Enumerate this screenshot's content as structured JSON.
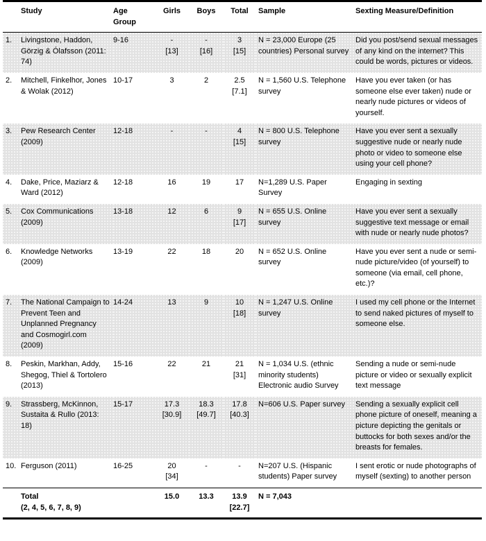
{
  "table": {
    "headers": {
      "number": "",
      "study": "Study",
      "age_group": "Age Group",
      "girls": "Girls",
      "boys": "Boys",
      "total": "Total",
      "sample": "Sample",
      "measure": "Sexting Measure/Definition"
    },
    "rows": [
      {
        "number": "1.",
        "study": "Livingstone, Haddon, Görzig & Ólafsson (2011: 74)",
        "age_group": "9-16",
        "girls": "-",
        "girls_bracket": "[13]",
        "boys": "-",
        "boys_bracket": "[16]",
        "total": "3",
        "total_bracket": "[15]",
        "sample": "N = 23,000 Europe (25 countries) Personal survey",
        "measure": "Did you post/send sexual messages of any kind on the internet? This could be words, pictures or videos.",
        "shaded": true
      },
      {
        "number": "2.",
        "study": "Mitchell, Finkelhor, Jones & Wolak (2012)",
        "age_group": "10-17",
        "girls": "3",
        "girls_bracket": "",
        "boys": "2",
        "boys_bracket": "",
        "total": "2.5",
        "total_bracket": "[7.1]",
        "sample": "N = 1,560 U.S. Telephone survey",
        "measure": "Have you ever taken (or has someone else ever taken) nude or nearly nude pictures or videos of yourself.",
        "shaded": false
      },
      {
        "number": "3.",
        "study": "Pew Research Center (2009)",
        "age_group": "12-18",
        "girls": "-",
        "girls_bracket": "",
        "boys": "-",
        "boys_bracket": "",
        "total": "4",
        "total_bracket": "[15]",
        "sample": "N = 800 U.S. Telephone survey",
        "measure": "Have you ever sent a sexually suggestive nude or nearly nude photo or video to someone else using your cell phone?",
        "shaded": true
      },
      {
        "number": "4.",
        "study": "Dake, Price, Maziarz & Ward (2012)",
        "age_group": "12-18",
        "girls": "16",
        "girls_bracket": "",
        "boys": "19",
        "boys_bracket": "",
        "total": "17",
        "total_bracket": "",
        "sample": "N=1,289 U.S. Paper Survey",
        "measure": "Engaging in sexting",
        "shaded": false
      },
      {
        "number": "5.",
        "study": "Cox Communications (2009)",
        "age_group": "13-18",
        "girls": "12",
        "girls_bracket": "",
        "boys": "6",
        "boys_bracket": "",
        "total": "9",
        "total_bracket": "[17]",
        "sample": "N = 655 U.S. Online survey",
        "measure": "Have you ever sent a sexually suggestive text message or email with nude or nearly nude photos?",
        "shaded": true
      },
      {
        "number": "6.",
        "study": "Knowledge Networks (2009)",
        "age_group": "13-19",
        "girls": "22",
        "girls_bracket": "",
        "boys": "18",
        "boys_bracket": "",
        "total": "20",
        "total_bracket": "",
        "sample": "N = 652 U.S. Online survey",
        "measure": "Have you ever sent a nude or semi-nude picture/video (of yourself) to someone (via email, cell phone, etc.)?",
        "shaded": false
      },
      {
        "number": "7.",
        "study": "The National Campaign to Prevent Teen and Unplanned Pregnancy and Cosmogirl.com (2009)",
        "age_group": "14-24",
        "girls": "13",
        "girls_bracket": "",
        "boys": "9",
        "boys_bracket": "",
        "total": "10",
        "total_bracket": "[18]",
        "sample": "N = 1,247 U.S. Online survey",
        "measure": "I used my cell phone or the Internet to send naked pictures of myself to someone else.",
        "shaded": true
      },
      {
        "number": "8.",
        "study": "Peskin, Markhan, Addy, Shegog, Thiel & Tortolero (2013)",
        "age_group": "15-16",
        "girls": "22",
        "girls_bracket": "",
        "boys": "21",
        "boys_bracket": "",
        "total": "21",
        "total_bracket": "[31]",
        "sample": "N = 1,034 U.S. (ethnic minority students) Electronic audio Survey",
        "measure": "Sending a nude or semi-nude picture or video or sexually explicit text message",
        "shaded": false
      },
      {
        "number": "9.",
        "study": "Strassberg, McKinnon, Sustaita & Rullo (2013: 18)",
        "age_group": "15-17",
        "girls": "17.3",
        "girls_bracket": "[30.9]",
        "boys": "18.3",
        "boys_bracket": "[49.7]",
        "total": "17.8",
        "total_bracket": "[40.3]",
        "sample": "N=606 U.S. Paper survey",
        "measure": "Sending a sexually explicit cell phone picture of oneself, meaning a picture depicting the genitals or buttocks for both sexes and/or the breasts for females.",
        "shaded": true
      },
      {
        "number": "10.",
        "study": "Ferguson (2011)",
        "age_group": "16-25",
        "girls": "20",
        "girls_bracket": "[34]",
        "boys": "-",
        "boys_bracket": "",
        "total": "-",
        "total_bracket": "",
        "sample": "N=207 U.S. (Hispanic students) Paper survey",
        "measure": "I sent erotic or nude photographs of myself (sexting) to another person",
        "shaded": false
      }
    ],
    "total_row": {
      "label": "Total",
      "sublabel": "(2, 4, 5, 6, 7, 8, 9)",
      "age_group": "",
      "girls": "15.0",
      "boys": "13.3",
      "total": "13.9",
      "total_bracket": "[22.7]",
      "sample": "N = 7,043",
      "measure": ""
    }
  }
}
